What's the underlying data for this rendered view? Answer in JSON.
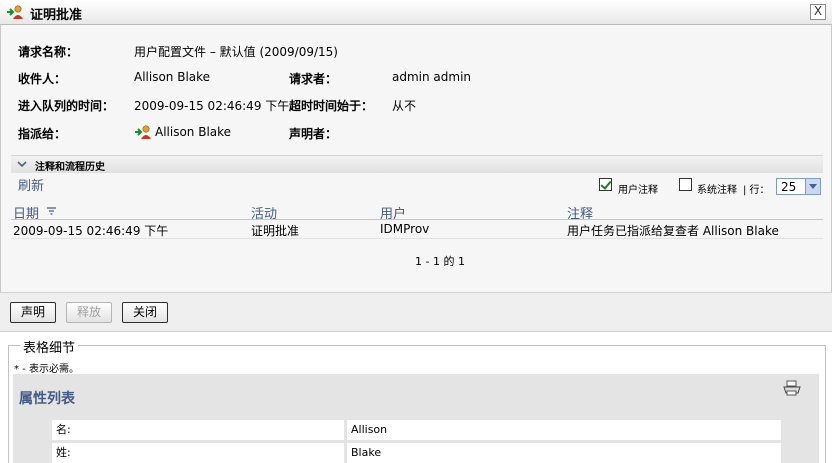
{
  "window": {
    "title": "证明批准",
    "title_icon": "user-approval-icon",
    "close_label": "X"
  },
  "details": {
    "request_name_label": "请求名称：",
    "request_name_value": "用户配置文件 – 默认值 (2009/09/15)",
    "recipient_label": "收件人：",
    "recipient_value": "Allison Blake",
    "requester_label": "请求者：",
    "requester_value": "admin admin",
    "queued_label": "进入队列的时间：",
    "queued_value": "2009-09-15 02:46:49 下午",
    "timeout_label": "超时时间始于：",
    "timeout_value": "从不",
    "assigned_label": "指派给：",
    "assigned_value": "Allison Blake",
    "claimer_label": "声明者："
  },
  "history": {
    "section_label": "注释和流程历史",
    "refresh_label": "刷新",
    "user_comments_label": "用户注释",
    "user_comments_checked": true,
    "system_comments_label": "系统注释",
    "system_comments_checked": false,
    "rows_label": "| 行：",
    "rows_value": "25",
    "columns": {
      "date": "日期",
      "activity": "活动",
      "user": "用户",
      "comment": "注释"
    },
    "rows": [
      {
        "date": "2009-09-15 02:46:49 下午",
        "activity": "证明批准",
        "user": "IDMProv",
        "comment": "用户任务已指派给复查者 Allison Blake"
      }
    ],
    "pager": "1 - 1 的 1"
  },
  "buttons": {
    "claim": "声明",
    "release": "释放",
    "close": "关闭"
  },
  "form": {
    "legend": "表格细节",
    "required_note": "* - 表示必需。",
    "attr_title": "属性列表",
    "print_icon": "print-icon",
    "fields": [
      {
        "label": "名:",
        "value": "Allison"
      },
      {
        "label": "姓:",
        "value": "Blake"
      }
    ]
  },
  "colors": {
    "accent": "#445a86",
    "panel_bg": "#f6f6f6",
    "attr_bg": "#e4e4e4"
  }
}
